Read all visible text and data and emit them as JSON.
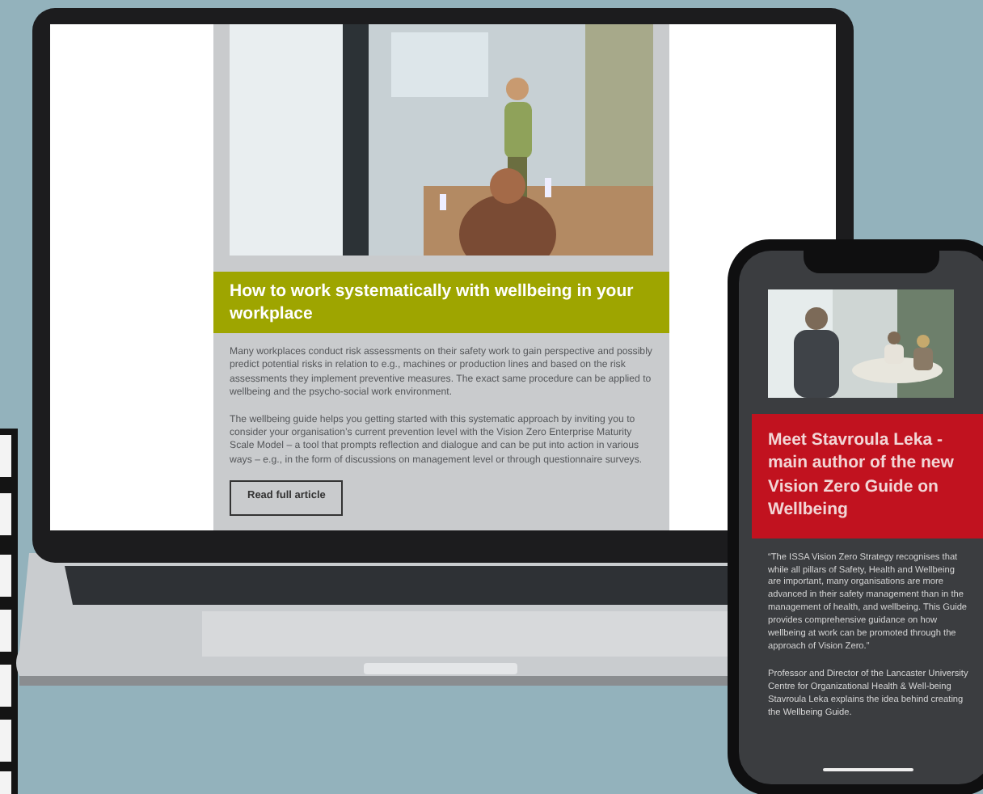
{
  "laptop_page": {
    "headline": "How to work systematically with wellbeing in your workplace",
    "paragraphs": [
      "Many workplaces conduct risk assessments on their safety work to gain perspective and possibly predict potential risks in relation to e.g., machines or production lines and based on the risk assessments they implement preventive measures. The exact same procedure can be applied to wellbeing and the psycho-social work environment.",
      "The wellbeing guide helps you getting started with this systematic approach by inviting you to consider your organisation’s current prevention level with the Vision Zero Enterprise Maturity Scale Model – a tool that prompts reflection and dialogue and can be put into action in various ways – e.g., in the form of discussions on management level or through questionnaire surveys."
    ],
    "button": "Read full article"
  },
  "phone_page": {
    "headline": "Meet Stavroula Leka - main author of the new Vision Zero Guide on Wellbeing",
    "paragraphs": [
      "“The ISSA Vision Zero Strategy recognises that while all pillars of Safety, Health and Wellbeing are important, many organisations are more advanced in their safety management than in the management of health, and wellbeing. This Guide provides comprehensive guidance on how wellbeing at work can be promoted through the approach of Vision Zero.”",
      "Professor and Director of the Lancaster University Centre for Organizational Health & Well-being Stavroula Leka explains the idea behind creating the Wellbeing Guide."
    ]
  }
}
